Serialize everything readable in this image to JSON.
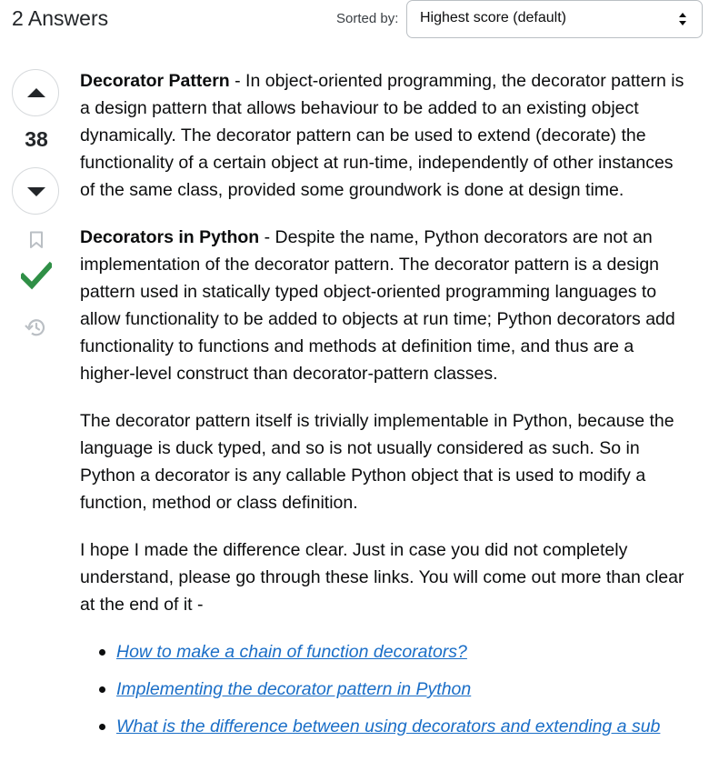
{
  "header": {
    "answers_count": "2 Answers",
    "sort_label": "Sorted by:",
    "sort_value": "Highest score (default)"
  },
  "vote": {
    "score": "38",
    "accepted_color": "#2f8f46"
  },
  "icons": {
    "upvote": "upvote-arrow-icon",
    "downvote": "downvote-arrow-icon",
    "bookmark": "bookmark-icon",
    "accepted": "checkmark-icon",
    "history": "history-icon"
  },
  "answer": {
    "p1_title": "Decorator Pattern",
    "p1_text": " - In object-oriented programming, the decorator pattern is a design pattern that allows behaviour to be added to an existing object dynamically. The decorator pattern can be used to extend (decorate) the functionality of a certain object at run-time, independently of other instances of the same class, provided some groundwork is done at design time.",
    "p2_title": "Decorators in Python",
    "p2_text": " - Despite the name, Python decorators are not an implementation of the decorator pattern. The decorator pattern is a design pattern used in statically typed object-oriented programming languages to allow functionality to be added to objects at run time; Python decorators add functionality to functions and methods at definition time, and thus are a higher-level construct than decorator-pattern classes.",
    "p3": "The decorator pattern itself is trivially implementable in Python, because the language is duck typed, and so is not usually considered as such. So in Python a decorator is any callable Python object that is used to modify a function, method or class definition.",
    "p4": "I hope I made the difference clear. Just in case you did not completely understand, please go through these links. You will come out more than clear at the end of it -",
    "links": [
      "How to make a chain of function decorators?",
      "Implementing the decorator pattern in Python",
      "What is the difference between using decorators and extending a sub"
    ]
  }
}
